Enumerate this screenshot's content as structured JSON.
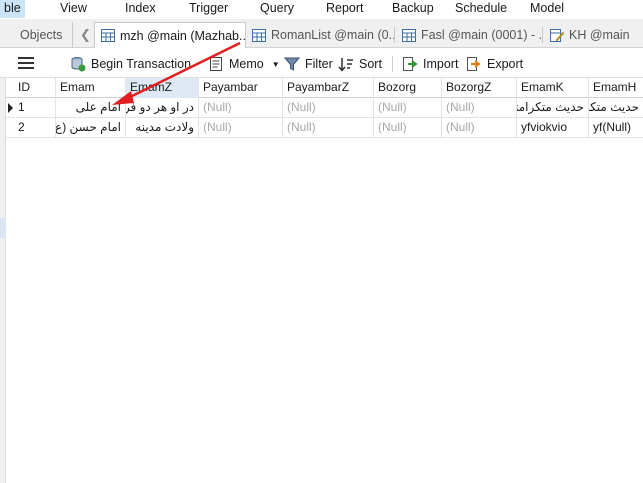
{
  "menu": {
    "items": [
      "ble",
      "View",
      "Index",
      "Trigger",
      "Query",
      "Report",
      "Backup",
      "Schedule",
      "Model"
    ]
  },
  "tabs": {
    "objects_label": "Objects",
    "items": [
      {
        "label": "mzh @main (Mazhab...",
        "active": true
      },
      {
        "label": "RomanList @main (0...",
        "active": false
      },
      {
        "label": "Fasl @main (0001) - ...",
        "active": false
      },
      {
        "label": "KH @main",
        "active": false
      }
    ]
  },
  "toolbar": {
    "begin_transaction": "Begin Transaction",
    "memo": "Memo",
    "filter": "Filter",
    "sort": "Sort",
    "import": "Import",
    "export": "Export"
  },
  "table": {
    "columns": [
      "ID",
      "Emam",
      "EmamZ",
      "Payambar",
      "PayambarZ",
      "Bozorg",
      "BozorgZ",
      "EmamK",
      "EmamH"
    ],
    "sorted_column": "EmamZ",
    "rows": [
      [
        "1",
        "امام علی",
        "در او هر دو فر",
        "(Null)",
        "(Null)",
        "(Null)",
        "(Null)",
        "حدیث متکرامتکرامتک",
        "حدیث متکرامتکرامتک"
      ],
      [
        "2",
        "امام حسن (ع)",
        "ولادت مدینه",
        "(Null)",
        "(Null)",
        "(Null)",
        "(Null)",
        "yfviokvio",
        "yf(Null)"
      ]
    ]
  },
  "colors": {
    "accent": "#cce4f7",
    "arrow": "#e02020",
    "null_text": "#a8a8a8"
  },
  "icons": {
    "menu": "hamburger-icon",
    "begin_transaction": "database-transaction-icon",
    "memo": "memo-icon",
    "filter": "filter-icon",
    "sort": "sort-icon",
    "import": "import-icon",
    "export": "export-icon",
    "table_tab": "table-icon",
    "design_tab": "design-table-icon"
  }
}
